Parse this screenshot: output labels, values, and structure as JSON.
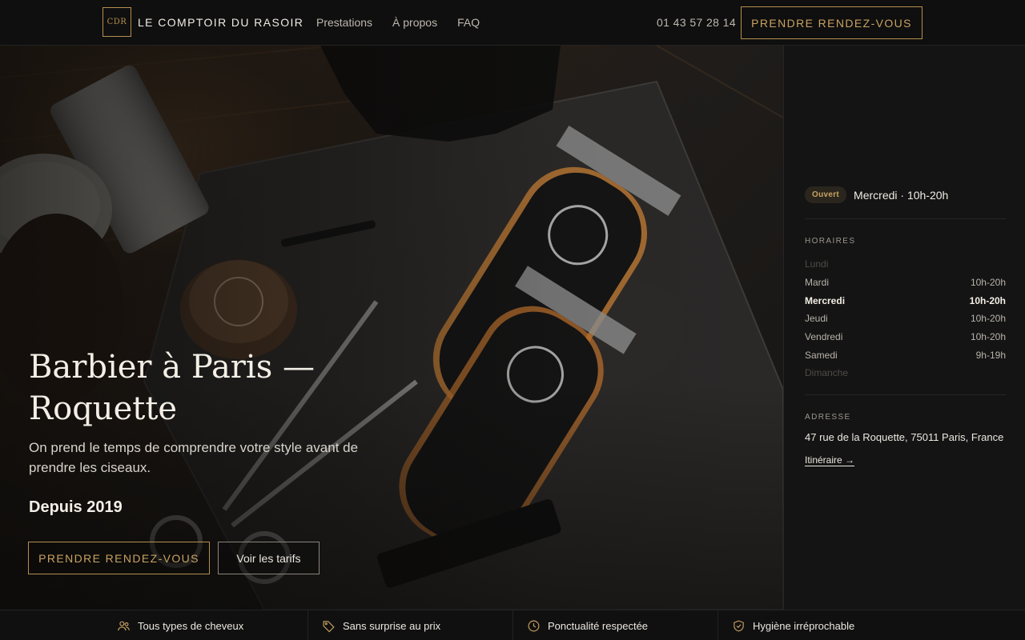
{
  "header": {
    "logo_text": "CDR",
    "brand": "LE COMPTOIR DU RASOIR",
    "nav": [
      "Prestations",
      "À propos",
      "FAQ"
    ],
    "phone": "01 43 57 28 14",
    "cta": "PRENDRE RENDEZ-VOUS"
  },
  "hero": {
    "title": "Barbier à Paris — Roquette",
    "subtitle": "On prend le temps de comprendre votre style avant de prendre les ciseaux.",
    "since": "Depuis 2019",
    "cta_primary": "PRENDRE RENDEZ-VOUS",
    "cta_secondary": "Voir les tarifs"
  },
  "sidebar": {
    "status_badge": "Ouvert",
    "today": "Mercredi · 10h-20h",
    "hours_label": "HORAIRES",
    "hours": [
      {
        "day": "Lundi",
        "time": "",
        "state": "closed"
      },
      {
        "day": "Mardi",
        "time": "10h-20h",
        "state": "open"
      },
      {
        "day": "Mercredi",
        "time": "10h-20h",
        "state": "today"
      },
      {
        "day": "Jeudi",
        "time": "10h-20h",
        "state": "open"
      },
      {
        "day": "Vendredi",
        "time": "10h-20h",
        "state": "open"
      },
      {
        "day": "Samedi",
        "time": "9h-19h",
        "state": "open"
      },
      {
        "day": "Dimanche",
        "time": "",
        "state": "closed"
      }
    ],
    "address_label": "ADRESSE",
    "address": "47 rue de la Roquette, 75011 Paris, France",
    "itinerary": "Itinéraire →"
  },
  "features": [
    {
      "icon": "users-icon",
      "label": "Tous types de cheveux"
    },
    {
      "icon": "tag-icon",
      "label": "Sans surprise au prix"
    },
    {
      "icon": "clock-icon",
      "label": "Ponctualité respectée"
    },
    {
      "icon": "shield-check-icon",
      "label": "Hygiène irréprochable"
    }
  ],
  "colors": {
    "accent": "#c9a262",
    "background": "#0f0f0f"
  }
}
